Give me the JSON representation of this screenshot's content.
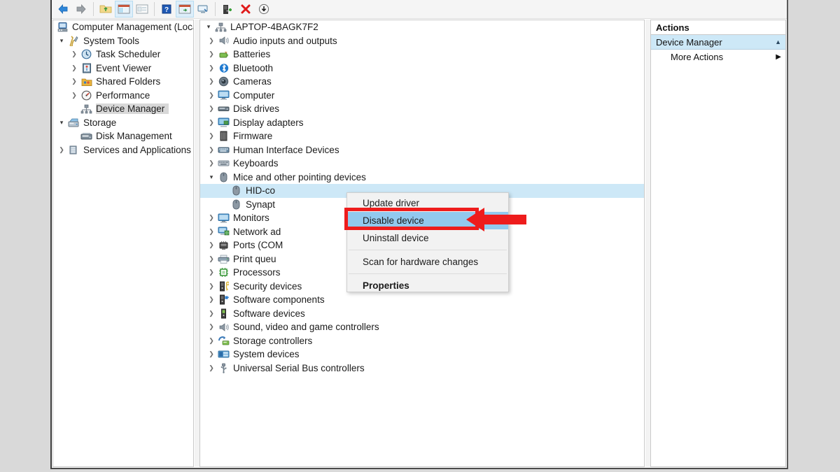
{
  "app": {
    "title": "Computer Management",
    "window_bg": "#ffffff",
    "desktop_bg": "#d9d9d9"
  },
  "colors": {
    "selection_blue": "#cde8f7",
    "menu_highlight": "#92c9ee",
    "annotation_red": "#ee1c1c",
    "menu_bg": "#f2f2f2",
    "toolbar_bg": "#f5f5f5"
  },
  "toolbar": {
    "buttons": [
      {
        "name": "back-arrow-icon",
        "label": "Back"
      },
      {
        "name": "forward-arrow-icon",
        "label": "Forward"
      },
      {
        "name": "up-folder-icon",
        "label": "Up one level"
      },
      {
        "name": "show-hide-console-tree-icon",
        "label": "Show/Hide Console Tree"
      },
      {
        "name": "export-list-icon",
        "label": "Export List"
      },
      {
        "name": "help-icon",
        "label": "Help"
      },
      {
        "name": "properties-window-icon",
        "label": "Properties"
      },
      {
        "name": "scan-hardware-icon",
        "label": "Scan for hardware changes"
      },
      {
        "name": "add-legacy-hardware-icon",
        "label": "Add legacy hardware"
      },
      {
        "name": "uninstall-device-icon",
        "label": "Uninstall device"
      },
      {
        "name": "update-driver-icon",
        "label": "Update driver"
      }
    ]
  },
  "console_tree": {
    "root": {
      "label": "Computer Management (Local)",
      "icon": "computer-management-icon",
      "expanded": true
    },
    "items": [
      {
        "label": "System Tools",
        "icon": "system-tools-icon",
        "depth": 1,
        "twisty": "open",
        "selected": false
      },
      {
        "label": "Task Scheduler",
        "icon": "clock-icon",
        "depth": 2,
        "twisty": "closed",
        "selected": false
      },
      {
        "label": "Event Viewer",
        "icon": "event-viewer-icon",
        "depth": 2,
        "twisty": "closed",
        "selected": false
      },
      {
        "label": "Shared Folders",
        "icon": "shared-folders-icon",
        "depth": 2,
        "twisty": "closed",
        "selected": false
      },
      {
        "label": "Performance",
        "icon": "performance-icon",
        "depth": 2,
        "twisty": "closed",
        "selected": false
      },
      {
        "label": "Device Manager",
        "icon": "device-manager-icon",
        "depth": 2,
        "twisty": "none",
        "selected": true
      },
      {
        "label": "Storage",
        "icon": "storage-icon",
        "depth": 1,
        "twisty": "open",
        "selected": false
      },
      {
        "label": "Disk Management",
        "icon": "disk-management-icon",
        "depth": 2,
        "twisty": "none",
        "selected": false
      },
      {
        "label": "Services and Applications",
        "icon": "services-apps-icon",
        "depth": 1,
        "twisty": "closed",
        "selected": false
      }
    ]
  },
  "device_tree": {
    "root": {
      "label": "LAPTOP-4BAGK7F2",
      "icon": "computer-node-icon",
      "expanded": true
    },
    "items": [
      {
        "label": "Audio inputs and outputs",
        "icon": "speaker-icon",
        "depth": 1,
        "twisty": "closed"
      },
      {
        "label": "Batteries",
        "icon": "battery-icon",
        "depth": 1,
        "twisty": "closed"
      },
      {
        "label": "Bluetooth",
        "icon": "bluetooth-icon",
        "depth": 1,
        "twisty": "closed"
      },
      {
        "label": "Cameras",
        "icon": "camera-icon",
        "depth": 1,
        "twisty": "closed"
      },
      {
        "label": "Computer",
        "icon": "monitor-icon",
        "depth": 1,
        "twisty": "closed"
      },
      {
        "label": "Disk drives",
        "icon": "disk-drive-icon",
        "depth": 1,
        "twisty": "closed"
      },
      {
        "label": "Display adapters",
        "icon": "display-adapter-icon",
        "depth": 1,
        "twisty": "closed"
      },
      {
        "label": "Firmware",
        "icon": "firmware-icon",
        "depth": 1,
        "twisty": "closed"
      },
      {
        "label": "Human Interface Devices",
        "icon": "hid-icon",
        "depth": 1,
        "twisty": "closed"
      },
      {
        "label": "Keyboards",
        "icon": "keyboard-icon",
        "depth": 1,
        "twisty": "closed"
      },
      {
        "label": "Mice and other pointing devices",
        "icon": "mouse-icon",
        "depth": 1,
        "twisty": "open"
      },
      {
        "label": "HID-co",
        "icon": "mouse-icon",
        "depth": 2,
        "twisty": "none",
        "selected": true
      },
      {
        "label": "Synapt",
        "icon": "mouse-icon",
        "depth": 2,
        "twisty": "none"
      },
      {
        "label": "Monitors",
        "icon": "monitor-icon",
        "depth": 1,
        "twisty": "closed"
      },
      {
        "label": "Network ad",
        "icon": "network-adapter-icon",
        "depth": 1,
        "twisty": "closed"
      },
      {
        "label": "Ports (COM",
        "icon": "ports-icon",
        "depth": 1,
        "twisty": "closed"
      },
      {
        "label": "Print queu",
        "icon": "printer-icon",
        "depth": 1,
        "twisty": "closed"
      },
      {
        "label": "Processors",
        "icon": "processor-icon",
        "depth": 1,
        "twisty": "closed"
      },
      {
        "label": "Security devices",
        "icon": "security-device-icon",
        "depth": 1,
        "twisty": "closed"
      },
      {
        "label": "Software components",
        "icon": "software-component-icon",
        "depth": 1,
        "twisty": "closed"
      },
      {
        "label": "Software devices",
        "icon": "software-device-icon",
        "depth": 1,
        "twisty": "closed"
      },
      {
        "label": "Sound, video and game controllers",
        "icon": "speaker-icon",
        "depth": 1,
        "twisty": "closed"
      },
      {
        "label": "Storage controllers",
        "icon": "storage-controller-icon",
        "depth": 1,
        "twisty": "closed"
      },
      {
        "label": "System devices",
        "icon": "system-device-icon",
        "depth": 1,
        "twisty": "closed"
      },
      {
        "label": "Universal Serial Bus controllers",
        "icon": "usb-icon",
        "depth": 1,
        "twisty": "closed"
      }
    ]
  },
  "context_menu": {
    "items": [
      {
        "label": "Update driver",
        "highlighted": false,
        "bold": false
      },
      {
        "label": "Disable device",
        "highlighted": true,
        "bold": false
      },
      {
        "label": "Uninstall device",
        "highlighted": false,
        "bold": false
      },
      {
        "label": "Scan for hardware changes",
        "highlighted": false,
        "bold": false
      },
      {
        "label": "Properties",
        "highlighted": false,
        "bold": true
      }
    ]
  },
  "actions_pane": {
    "header": "Actions",
    "group": "Device Manager",
    "group_caret": "▲",
    "items": [
      {
        "label": "More Actions",
        "caret": "▶"
      }
    ]
  },
  "annotation": {
    "highlight_target": "Disable device",
    "arrow_direction": "left",
    "color": "#ee1c1c"
  }
}
